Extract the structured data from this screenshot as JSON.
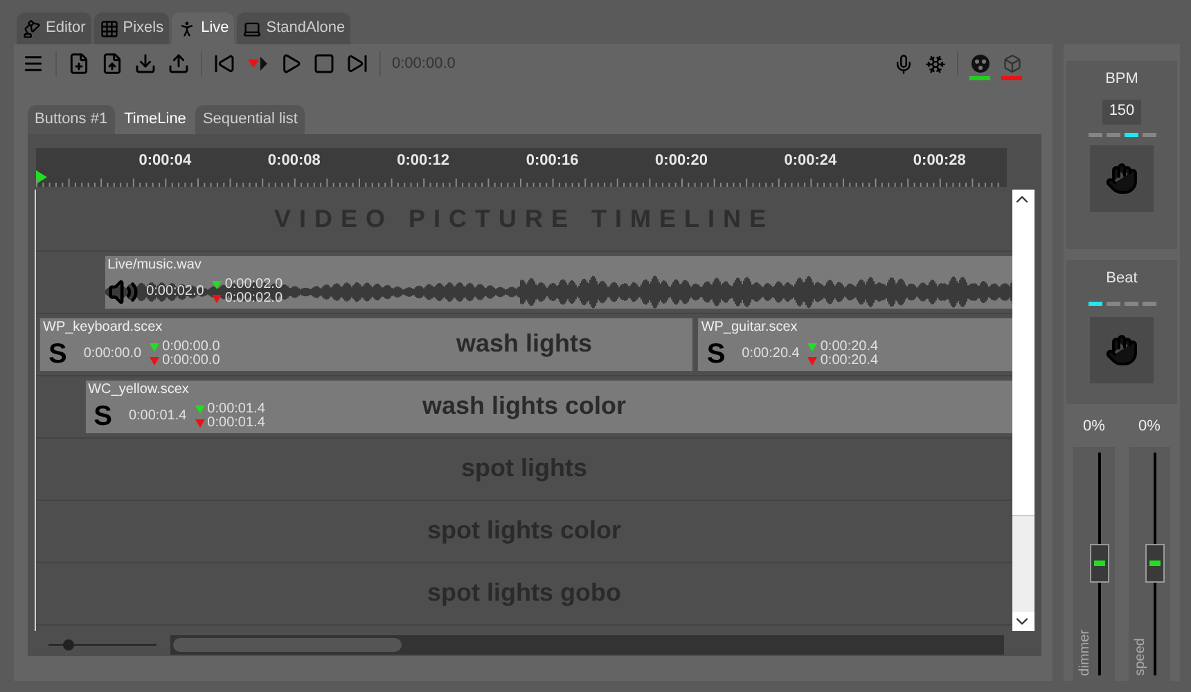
{
  "tabs": [
    {
      "label": "Editor",
      "kind": "editor",
      "selected": false
    },
    {
      "label": "Pixels",
      "kind": "pixels",
      "selected": false
    },
    {
      "label": "Live",
      "kind": "live",
      "selected": true
    },
    {
      "label": "StandAlone",
      "kind": "standalone",
      "selected": false
    }
  ],
  "toolbar": {
    "time": "0:00:00.0",
    "status": [
      {
        "kind": "dmx",
        "color": "#22cc22"
      },
      {
        "kind": "cube",
        "color": "#ee1111"
      }
    ]
  },
  "subtabs": [
    {
      "label": "Buttons #1",
      "selected": false
    },
    {
      "label": "TimeLine",
      "selected": true
    },
    {
      "label": "Sequential list",
      "selected": false
    }
  ],
  "ruler": [
    "0:00:04",
    "0:00:08",
    "0:00:12",
    "0:00:16",
    "0:00:20",
    "0:00:24",
    "0:00:28"
  ],
  "tracks": [
    {
      "kind": "header",
      "label": "VIDEO PICTURE TIMELINE"
    },
    {
      "kind": "audio",
      "clips": [
        {
          "kind": "audio",
          "name": "Live/music.wav",
          "start": "0:00:02.0",
          "fade_in": "0:00:02.0",
          "fade_out": "0:00:02.0"
        }
      ]
    },
    {
      "kind": "lights",
      "label": "wash lights",
      "clips": [
        {
          "kind": "scene",
          "name": "WP_keyboard.scex",
          "mark": "S",
          "start": "0:00:00.0",
          "fade_in": "0:00:00.0",
          "fade_out": "0:00:00.0"
        },
        {
          "kind": "scene",
          "name": "WP_guitar.scex",
          "mark": "S",
          "start": "0:00:20.4",
          "fade_in": "0:00:20.4",
          "fade_out": "0:00:20.4"
        }
      ]
    },
    {
      "kind": "lights",
      "label": "wash lights color",
      "clips": [
        {
          "kind": "scene",
          "name": "WC_yellow.scex",
          "mark": "S",
          "start": "0:00:01.4",
          "fade_in": "0:00:01.4",
          "fade_out": "0:00:01.4"
        }
      ]
    },
    {
      "kind": "lights",
      "label": "spot lights"
    },
    {
      "kind": "lights",
      "label": "spot lights color"
    },
    {
      "kind": "lights",
      "label": "spot lights gobo"
    }
  ],
  "bpm": {
    "title": "BPM",
    "value": "150",
    "beats": [
      {
        "selected": false
      },
      {
        "selected": false
      },
      {
        "selected": true
      },
      {
        "selected": false
      }
    ]
  },
  "beat": {
    "title": "Beat",
    "beats": [
      {
        "selected": true
      },
      {
        "selected": false
      },
      {
        "selected": false
      },
      {
        "selected": false
      }
    ]
  },
  "zoom": {
    "level": 0.15
  },
  "faders": [
    {
      "reading": "0%",
      "label": "dimmer",
      "level": 0.5
    },
    {
      "reading": "0%",
      "label": "speed",
      "level": 0.5
    }
  ]
}
